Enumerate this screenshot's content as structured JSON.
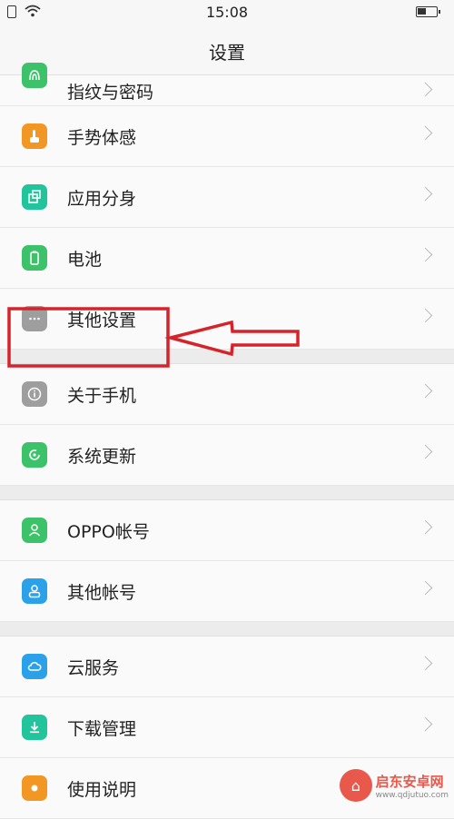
{
  "status": {
    "time": "15:08"
  },
  "header": {
    "title": "设置"
  },
  "colors": {
    "green": "#3cc36a",
    "orange": "#f29624",
    "teal": "#22c49b",
    "gray": "#9e9e9e",
    "blue": "#2aa1e8",
    "red_annotation": "#d6232b"
  },
  "items": [
    {
      "label": "指纹与密码",
      "icon": "fingerprint-icon"
    },
    {
      "label": "手势体感",
      "icon": "gesture-icon"
    },
    {
      "label": "应用分身",
      "icon": "clone-app-icon"
    },
    {
      "label": "电池",
      "icon": "battery-icon"
    },
    {
      "label": "其他设置",
      "icon": "more-dots-icon"
    },
    {
      "label": "关于手机",
      "icon": "info-icon"
    },
    {
      "label": "系统更新",
      "icon": "update-icon"
    },
    {
      "label": "OPPO帐号",
      "icon": "person-icon"
    },
    {
      "label": "其他帐号",
      "icon": "account-icon"
    },
    {
      "label": "云服务",
      "icon": "cloud-icon"
    },
    {
      "label": "下载管理",
      "icon": "download-icon"
    },
    {
      "label": "使用说明",
      "icon": "sun-icon"
    }
  ],
  "watermark": {
    "name": "启东安卓网",
    "url": "www.qdjutuo.com"
  }
}
